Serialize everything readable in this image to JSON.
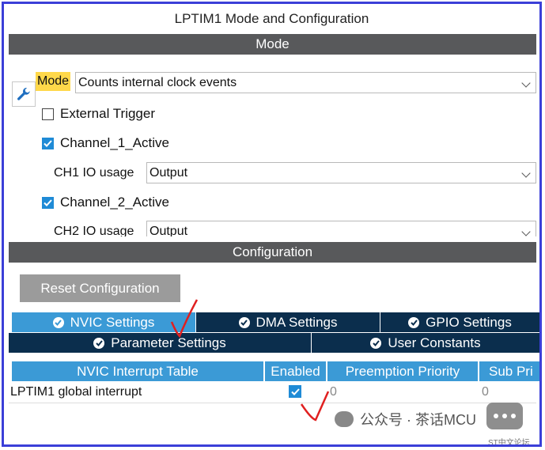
{
  "window": {
    "title": "LPTIM1 Mode and Configuration"
  },
  "mode_section": {
    "header": "Mode",
    "mode_label": "Mode",
    "mode_value": "Counts internal clock events",
    "external_trigger": {
      "label": "External Trigger",
      "checked": false
    },
    "channel1": {
      "label": "Channel_1_Active",
      "checked": true
    },
    "ch1_io": {
      "label": "CH1 IO usage",
      "value": "Output"
    },
    "channel2": {
      "label": "Channel_2_Active",
      "checked": true
    },
    "ch2_io": {
      "label": "CH2 IO usage",
      "value": "Output"
    }
  },
  "config_section": {
    "header": "Configuration",
    "reset_button": "Reset Configuration",
    "tabs_row1": [
      "NVIC Settings",
      "DMA Settings",
      "GPIO Settings"
    ],
    "tabs_row2": [
      "Parameter Settings",
      "User Constants"
    ],
    "active_tab": "NVIC Settings",
    "table": {
      "columns": [
        "NVIC Interrupt Table",
        "Enabled",
        "Preemption Priority",
        "Sub Pri"
      ],
      "rows": [
        {
          "name": "LPTIM1 global interrupt",
          "enabled": true,
          "preemption": "0",
          "sub": "0"
        }
      ]
    }
  },
  "watermark": {
    "text": "公众号 · 茶话MCU",
    "small": "ST中文论坛"
  },
  "colors": {
    "border": "#3b3fd8",
    "band": "#58595b",
    "tab_dark": "#0b2e4d",
    "tab_active": "#3b9ad6",
    "mode_highlight": "#ffd84a",
    "annotation": "#e02020"
  }
}
